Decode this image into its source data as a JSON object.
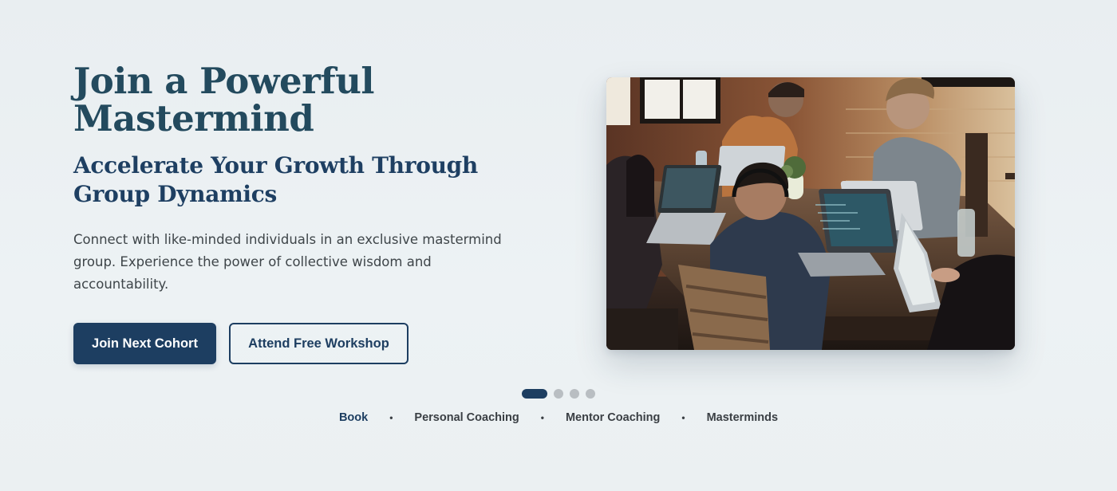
{
  "hero": {
    "headline": "Join a Powerful Mastermind",
    "subheadline": "Accelerate Your Growth Through Group Dynamics",
    "body": "Connect with like-minded individuals in an exclusive mastermind group. Experience the power of collective wisdom and accountability.",
    "primary_cta": "Join Next Cohort",
    "secondary_cta": "Attend Free Workshop",
    "image_alt": "people-collaborating-at-table-photo"
  },
  "carousel": {
    "slide_count": 4,
    "active_index": 0
  },
  "footer_nav": {
    "items": [
      "Book",
      "Personal Coaching",
      "Mentor Coaching",
      "Masterminds"
    ],
    "separator": "•"
  },
  "colors": {
    "brand_navy": "#1d3e61",
    "headline_teal": "#234a5e",
    "body_text": "#3e4549",
    "inactive_dot": "#b9bec2"
  }
}
